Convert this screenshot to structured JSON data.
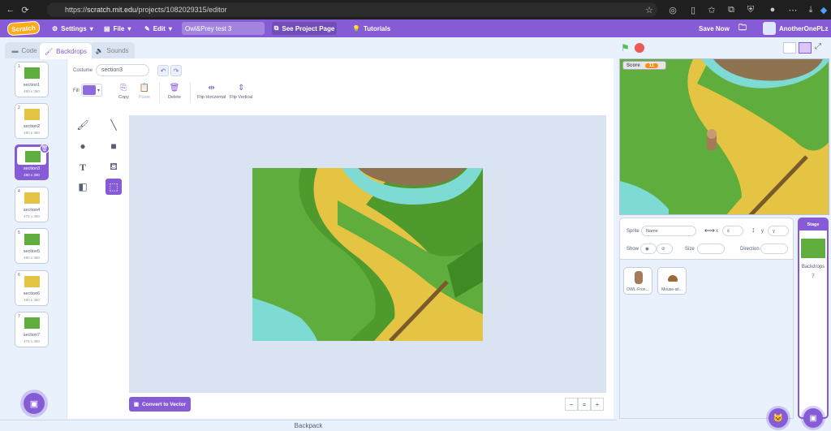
{
  "browser": {
    "url_scheme": "https://",
    "url_host": "scratch.mit.edu",
    "url_path": "/projects/1082029315/editor"
  },
  "menubar": {
    "logo": "Scratch",
    "settings": "Settings",
    "file": "File",
    "edit": "Edit",
    "project_title": "Owl&Prey test 3",
    "see_project_page": "See Project Page",
    "tutorials": "Tutorials",
    "save_now": "Save Now",
    "username": "AnotherOnePLz"
  },
  "tabs": {
    "code": "Code",
    "backdrops": "Backdrops",
    "sounds": "Sounds"
  },
  "backdrops": [
    {
      "num": "1",
      "name": "section1",
      "size": "480 x 360",
      "color": "#5fad3c"
    },
    {
      "num": "2",
      "name": "section2",
      "size": "480 x 360",
      "color": "#e6c443"
    },
    {
      "num": "3",
      "name": "section3",
      "size": "480 x 360",
      "color": "#5fad3c"
    },
    {
      "num": "4",
      "name": "section4",
      "size": "475 x 360",
      "color": "#e6c443"
    },
    {
      "num": "5",
      "name": "section5",
      "size": "480 x 360",
      "color": "#5fad3c"
    },
    {
      "num": "6",
      "name": "section6",
      "size": "480 x 360",
      "color": "#e6c443"
    },
    {
      "num": "7",
      "name": "section7",
      "size": "475 x 360",
      "color": "#5fad3c"
    }
  ],
  "selected_backdrop": 3,
  "editor": {
    "costume_label": "Costume",
    "costume_name": "section3",
    "fill_label": "Fill",
    "fill_color": "#8e6bdc",
    "copy": "Copy",
    "paste": "Paste",
    "delete": "Delete",
    "flip_horizontal": "Flip Horizontal",
    "flip_vertical": "Flip Vertical",
    "convert": "Convert to Vector"
  },
  "backpack": "Backpack",
  "stage": {
    "score_label": "Score",
    "score_value": "11"
  },
  "sprite_info": {
    "sprite_label": "Sprite",
    "name_placeholder": "Name",
    "x_label": "x",
    "x_placeholder": "x",
    "y_label": "y",
    "y_placeholder": "y",
    "show_label": "Show",
    "size_label": "Size",
    "direction_label": "Direction"
  },
  "sprites": [
    {
      "name": "OWL-Fron..."
    },
    {
      "name": "Mouse-sit..."
    }
  ],
  "stage_panel": {
    "title": "Stage",
    "backdrops_label": "Backdrops",
    "backdrops_count": "7"
  },
  "colors": {
    "accent": "#855cd6",
    "grass": "#5fad3c",
    "sand": "#e6c443",
    "water": "#7ddbd4"
  }
}
